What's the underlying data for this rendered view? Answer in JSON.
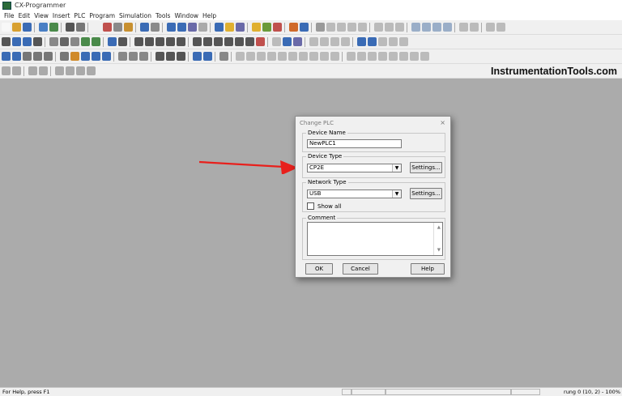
{
  "window": {
    "title": "CX-Programmer"
  },
  "menu": [
    "File",
    "Edit",
    "View",
    "Insert",
    "PLC",
    "Program",
    "Simulation",
    "Tools",
    "Window",
    "Help"
  ],
  "brand": "InstrumentationTools.com",
  "toolbars": [
    [
      "#f8f8f8",
      "#d8a030",
      "#3a6bb5",
      "sep",
      "#4a7fc4",
      "#4a8a4a",
      "sep",
      "#555555",
      "#777777",
      "sep",
      "#f0f0f0",
      "#c0504d",
      "#8a8a8a",
      "#c89030",
      "sep",
      "#3a6bb5",
      "#8a8a8a",
      "sep",
      "#3a6bb5",
      "#3a6bb5",
      "#6a6aa8",
      "#aaaaaa",
      "sep",
      "#3a6bb5",
      "#e0b030",
      "#6a6aa8",
      "sep",
      "#e0b030",
      "#6a9a3a",
      "#c0504d",
      "sep",
      "#d06a2a",
      "#3a6bb5",
      "sep",
      "#9a9a9a",
      "#bbbbbb",
      "#bbbbbb",
      "#bbbbbb",
      "#bbbbbb",
      "sep",
      "#bbbbbb",
      "#bbbbbb",
      "#bbbbbb",
      "sep",
      "#9aaec8",
      "#9aaec8",
      "#9aaec8",
      "#9aaec8",
      "sep",
      "#bbbbbb",
      "#bbbbbb",
      "sep",
      "#bbbbbb",
      "#bbbbbb"
    ],
    [
      "#555555",
      "#3a6bb5",
      "#3a6bb5",
      "#555555",
      "sep",
      "#888888",
      "#666666",
      "#888888",
      "#4a8a4a",
      "#4a8a4a",
      "sep",
      "#3a6bb5",
      "#555555",
      "sep",
      "#555555",
      "#555555",
      "#555555",
      "#555555",
      "#555555",
      "sep",
      "#555555",
      "#555555",
      "#555555",
      "#555555",
      "#555555",
      "#555555",
      "#c0504d",
      "sep",
      "#bbbbbb",
      "#3a6bb5",
      "#6a6aa8",
      "sep",
      "#bbbbbb",
      "#bbbbbb",
      "#bbbbbb",
      "#bbbbbb",
      "sep",
      "#3a6bb5",
      "#3a6bb5",
      "#bbbbbb",
      "#bbbbbb",
      "#bbbbbb"
    ],
    [
      "#3a6bb5",
      "#3a6bb5",
      "#777777",
      "#777777",
      "#777777",
      "sep",
      "#777777",
      "#d08a2a",
      "#3a6bb5",
      "#3a6bb5",
      "#3a6bb5",
      "sep",
      "#888888",
      "#888888",
      "#888888",
      "sep",
      "#555555",
      "#555555",
      "#555555",
      "sep",
      "#3a6bb5",
      "#3a6bb5",
      "sep",
      "#888888",
      "sep",
      "#bbbbbb",
      "#bbbbbb",
      "#bbbbbb",
      "#bbbbbb",
      "#bbbbbb",
      "#bbbbbb",
      "#bbbbbb",
      "#bbbbbb",
      "#bbbbbb",
      "#bbbbbb",
      "sep",
      "#bbbbbb",
      "#bbbbbb",
      "#bbbbbb",
      "#bbbbbb",
      "#bbbbbb",
      "#bbbbbb",
      "#bbbbbb",
      "#bbbbbb"
    ],
    [
      "#aaaaaa",
      "#aaaaaa",
      "sep",
      "#aaaaaa",
      "#aaaaaa",
      "sep",
      "#aaaaaa",
      "#aaaaaa",
      "#aaaaaa",
      "#aaaaaa"
    ]
  ],
  "dialog": {
    "title": "Change PLC",
    "close": "×",
    "device_name_label": "Device Name",
    "device_name_value": "NewPLC1",
    "device_type_label": "Device Type",
    "device_type_value": "CP2E",
    "device_settings": "Settings...",
    "network_type_label": "Network Type",
    "network_type_value": "USB",
    "network_settings": "Settings...",
    "show_all": "Show all",
    "comment_label": "Comment",
    "ok": "OK",
    "cancel": "Cancel",
    "help": "Help"
  },
  "annotation_arrow_color": "#e8201c",
  "status": {
    "help": "For Help, press F1",
    "position": "rung 0 (10, 2)  - 100%"
  }
}
